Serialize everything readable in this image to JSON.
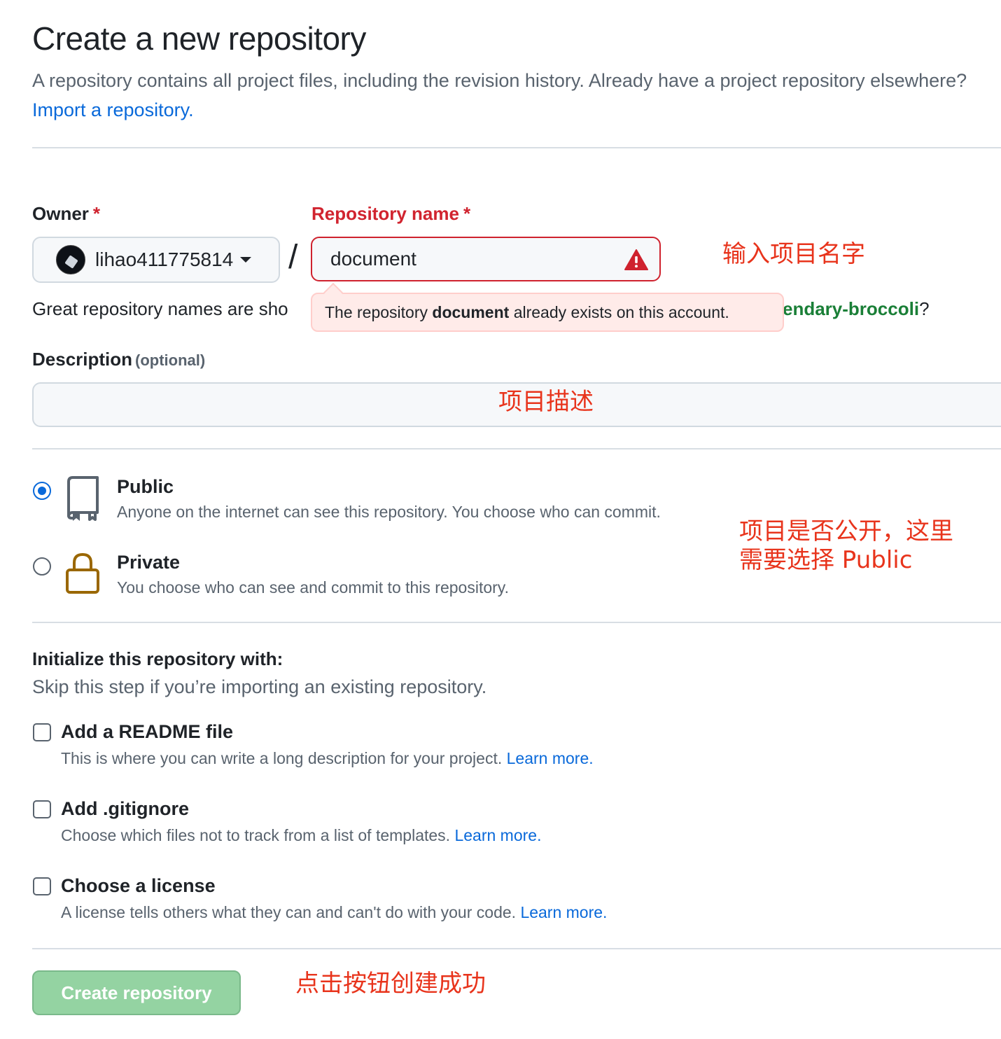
{
  "header": {
    "title": "Create a new repository",
    "intro_text": "A repository contains all project files, including the revision history. Already have a project repository elsewhere?",
    "import_link": "Import a repository."
  },
  "owner": {
    "label": "Owner",
    "required_mark": "*",
    "selected": "lihao411775814"
  },
  "separator": "/",
  "repo_name": {
    "label": "Repository name",
    "required_mark": "*",
    "value": "document",
    "error_prefix": "The repository",
    "error_name": "document",
    "error_suffix": "already exists on this account."
  },
  "name_hint": {
    "prefix": "Great repository names are sho",
    "suggestion": "endary-broccoli",
    "suffix": "?"
  },
  "description": {
    "label": "Description",
    "optional": "(optional)",
    "value": ""
  },
  "visibility": {
    "public_title": "Public",
    "public_desc": "Anyone on the internet can see this repository. You choose who can commit.",
    "private_title": "Private",
    "private_desc": "You choose who can see and commit to this repository.",
    "selected": "public"
  },
  "initialize": {
    "title": "Initialize this repository with:",
    "subtitle": "Skip this step if you’re importing an existing repository.",
    "options": [
      {
        "title": "Add a README file",
        "desc": "This is where you can write a long description for your project.",
        "link": "Learn more."
      },
      {
        "title": "Add .gitignore",
        "desc": "Choose which files not to track from a list of templates.",
        "link": "Learn more."
      },
      {
        "title": "Choose a license",
        "desc": "A license tells others what they can and can't do with your code.",
        "link": "Learn more."
      }
    ]
  },
  "submit": {
    "label": "Create repository"
  },
  "annotations": {
    "name_note": "输入项目名字",
    "desc_note": "项目描述",
    "visibility_note_line1": "项目是否公开，这里",
    "visibility_note_line2": "需要选择 Public",
    "button_note": "点击按钮创建成功"
  },
  "colors": {
    "link": "#0969da",
    "error": "#cf222e",
    "success": "#1a7f37",
    "button_disabled": "#94d3a2",
    "annotation": "#e8341c"
  }
}
